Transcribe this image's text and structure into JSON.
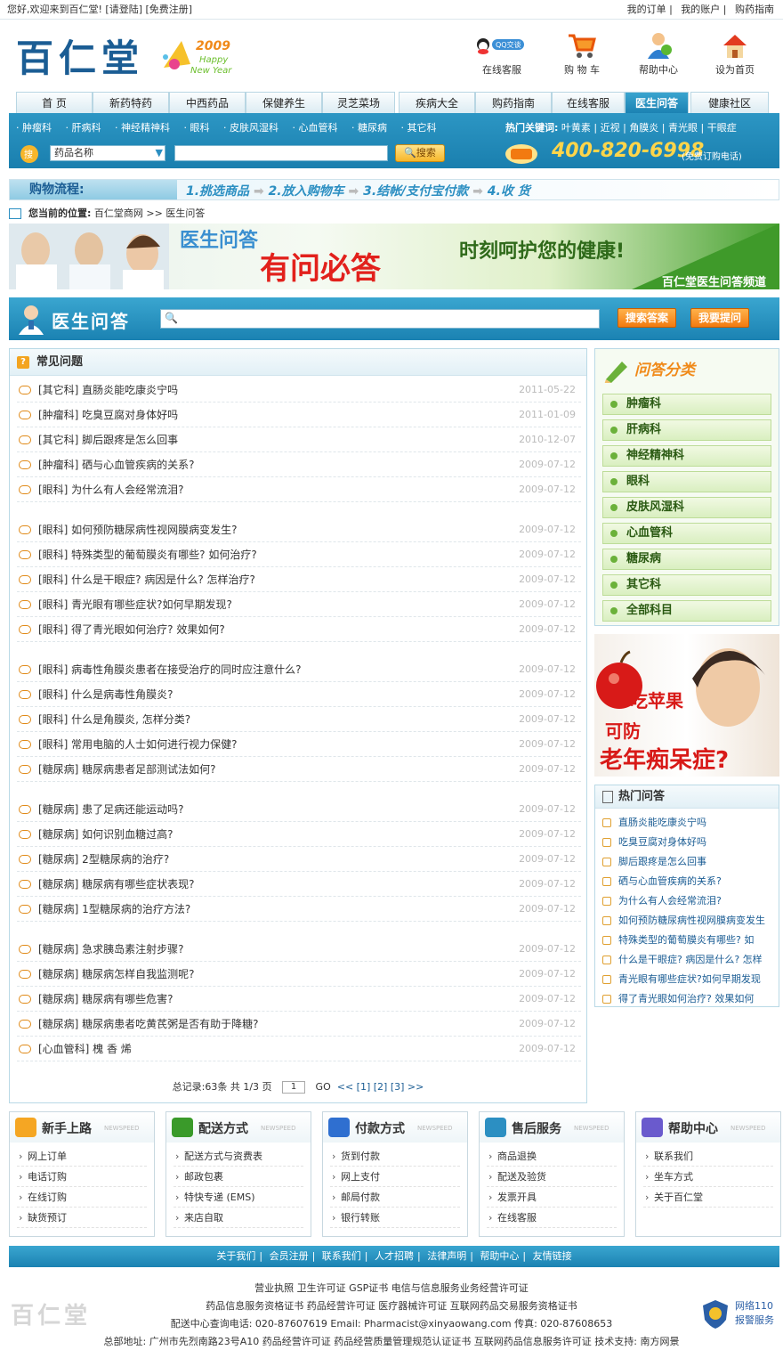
{
  "top": {
    "greeting": "您好,欢迎来到百仁堂! [请登陆] [免费注册]",
    "links": [
      "我的订单",
      "我的账户",
      "购药指南"
    ]
  },
  "logo": {
    "text": "百仁堂",
    "year": "2009",
    "happy": "Happy",
    "new_year": "New Year"
  },
  "top_icons": [
    "在线客服",
    "购 物 车",
    "帮助中心",
    "设为首页"
  ],
  "nav": [
    "首  页",
    "新药特药",
    "中西药品",
    "保健养生",
    "灵芝菜场",
    "疾病大全",
    "购药指南",
    "在线客服",
    "医生问答",
    "健康社区"
  ],
  "sub_links": [
    "肿瘤科",
    "肝病科",
    "神经精神科",
    "眼科",
    "皮肤风湿科",
    "心血管科",
    "糖尿病",
    "其它科"
  ],
  "hot_keywords_label": "热门关键词:",
  "hot_keywords": [
    "叶黄素",
    "近视",
    "角膜炎",
    "青光眼",
    "干眼症"
  ],
  "search": {
    "select": "药品名称",
    "button": "搜索"
  },
  "phone": {
    "number": "400-820-6998",
    "note": "(免费订购电话)"
  },
  "flow": {
    "label": "购物流程:",
    "steps": [
      "1.挑选商品",
      "2.放入购物车",
      "3.结帐/支付宝付款",
      "4.收  货"
    ]
  },
  "breadcrumb": {
    "label": "您当前的位置:",
    "path": [
      "百仁堂商网",
      "医生问答"
    ]
  },
  "banner": {
    "line1": "医生问答",
    "line2": "有问必答",
    "slogan": "时刻呵护您的健康!",
    "channel": "百仁堂医生问答频道"
  },
  "qa_bar": {
    "title": "医生问答",
    "search_btn": "搜索答案",
    "ask_btn": "我要提问"
  },
  "faq": {
    "title": "常见问题",
    "items": [
      {
        "q": "[其它科] 直肠炎能吃康炎宁吗",
        "d": "2011-05-22"
      },
      {
        "q": "[肿瘤科] 吃臭豆腐对身体好吗",
        "d": "2011-01-09"
      },
      {
        "q": "[其它科] 脚后跟疼是怎么回事",
        "d": "2010-12-07"
      },
      {
        "q": "[肿瘤科] 硒与心血管疾病的关系?",
        "d": "2009-07-12"
      },
      {
        "q": "[眼科] 为什么有人会经常流泪?",
        "d": "2009-07-12"
      },
      {
        "q": "[眼科] 如何预防糖尿病性视网膜病变发生?",
        "d": "2009-07-12"
      },
      {
        "q": "[眼科] 特殊类型的葡萄膜炎有哪些? 如何治疗?",
        "d": "2009-07-12"
      },
      {
        "q": "[眼科] 什么是干眼症? 病因是什么? 怎样治疗?",
        "d": "2009-07-12"
      },
      {
        "q": "[眼科] 青光眼有哪些症状?如何早期发现?",
        "d": "2009-07-12"
      },
      {
        "q": "[眼科] 得了青光眼如何治疗? 效果如何?",
        "d": "2009-07-12"
      },
      {
        "q": "[眼科] 病毒性角膜炎患者在接受治疗的同时应注意什么?",
        "d": "2009-07-12"
      },
      {
        "q": "[眼科] 什么是病毒性角膜炎?",
        "d": "2009-07-12"
      },
      {
        "q": "[眼科] 什么是角膜炎, 怎样分类?",
        "d": "2009-07-12"
      },
      {
        "q": "[眼科] 常用电脑的人士如何进行视力保健?",
        "d": "2009-07-12"
      },
      {
        "q": "[糖尿病] 糖尿病患者足部测试法如何?",
        "d": "2009-07-12"
      },
      {
        "q": "[糖尿病] 患了足病还能运动吗?",
        "d": "2009-07-12"
      },
      {
        "q": "[糖尿病] 如何识别血糖过高?",
        "d": "2009-07-12"
      },
      {
        "q": "[糖尿病] 2型糖尿病的治疗?",
        "d": "2009-07-12"
      },
      {
        "q": "[糖尿病] 糖尿病有哪些症状表现?",
        "d": "2009-07-12"
      },
      {
        "q": "[糖尿病] 1型糖尿病的治疗方法?",
        "d": "2009-07-12"
      },
      {
        "q": "[糖尿病] 急求胰岛素注射步骤?",
        "d": "2009-07-12"
      },
      {
        "q": "[糖尿病] 糖尿病怎样自我监测呢?",
        "d": "2009-07-12"
      },
      {
        "q": "[糖尿病] 糖尿病有哪些危害?",
        "d": "2009-07-12"
      },
      {
        "q": "[糖尿病] 糖尿病患者吃黄芪粥是否有助于降糖?",
        "d": "2009-07-12"
      },
      {
        "q": "[心血管科] 槐 香 烯",
        "d": "2009-07-12"
      }
    ],
    "pager": {
      "summary": "总记录:63条  共 1/3 页",
      "page": "1",
      "go": "GO",
      "pages": "<< [1] [2] [3] >>"
    }
  },
  "categories": {
    "title": "问答分类",
    "items": [
      "肿瘤科",
      "肝病科",
      "神经精神科",
      "眼科",
      "皮肤风湿科",
      "心血管科",
      "糖尿病",
      "其它科",
      "全部科目"
    ]
  },
  "ad": {
    "line1": "吃苹果",
    "line2": "可防",
    "line3": "老年痴呆症?"
  },
  "hot_questions": {
    "title": "热门问答",
    "items": [
      "直肠炎能吃康炎宁吗",
      "吃臭豆腐对身体好吗",
      "脚后跟疼是怎么回事",
      "硒与心血管疾病的关系?",
      "为什么有人会经常流泪?",
      "如何预防糖尿病性视网膜病变发生",
      "特殊类型的葡萄膜炎有哪些? 如",
      "什么是干眼症? 病因是什么? 怎样",
      "青光眼有哪些症状?如何早期发现",
      "得了青光眼如何治疗? 效果如何"
    ]
  },
  "bottom_boxes": [
    {
      "title": "新手上路",
      "en": "NEWSPEED",
      "items": [
        "网上订单",
        "电话订购",
        "在线订购",
        "缺货预订"
      ]
    },
    {
      "title": "配送方式",
      "en": "NEWSPEED",
      "items": [
        "配送方式与资费表",
        "邮政包裹",
        "特快专递 (EMS)",
        "来店自取"
      ]
    },
    {
      "title": "付款方式",
      "en": "NEWSPEED",
      "items": [
        "货到付款",
        "网上支付",
        "邮局付款",
        "银行转账"
      ]
    },
    {
      "title": "售后服务",
      "en": "NEWSPEED",
      "items": [
        "商品退换",
        "配送及验货",
        "发票开具",
        "在线客服"
      ]
    },
    {
      "title": "帮助中心",
      "en": "NEWSPEED",
      "items": [
        "联系我们",
        "坐车方式",
        "关于百仁堂"
      ]
    }
  ],
  "footer_nav": [
    "关于我们",
    "会员注册",
    "联系我们",
    "人才招聘",
    "法律声明",
    "帮助中心",
    "友情链接"
  ],
  "footer": {
    "line1": "营业执照  卫生许可证  GSP证书  电信与信息服务业务经营许可证",
    "line2": "药品信息服务资格证书  药品经营许可证  医疗器械许可证  互联网药品交易服务资格证书",
    "line3": "配送中心查询电话: 020-87607619  Email: Pharmacist@xinyaowang.com  传真: 020-87608653",
    "line4": "总部地址: 广州市先烈南路23号A10  药品经营许可证  药品经营质量管理规范认证证书  互联网药品信息服务许可证  技术支持: 南方网景",
    "logo": "百仁堂",
    "police": [
      "网络110",
      "报警服务"
    ]
  },
  "colors": {
    "primary": "#1c82b3",
    "accent": "#f27a10",
    "green": "#6bb13a"
  }
}
